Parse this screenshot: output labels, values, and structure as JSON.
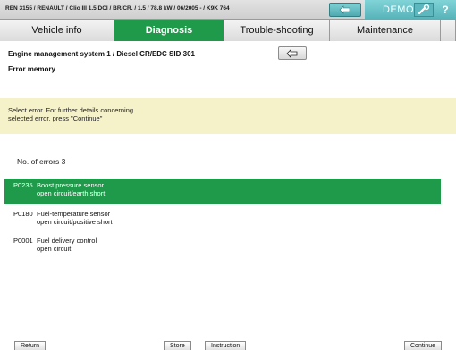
{
  "header": {
    "vehicle_id": "REN 3155 / RENAULT / Clio III 1.5 DCI / BR/CR. / 1.5 / 78.8 kW / 06/2005 - / K9K 764",
    "demo_label": "DEMO",
    "help_label": "?"
  },
  "tabs": [
    {
      "label": "Vehicle info"
    },
    {
      "label": "Diagnosis"
    },
    {
      "label": "Trouble-shooting"
    },
    {
      "label": "Maintenance"
    }
  ],
  "main": {
    "system_title": "Engine management system 1 / Diesel CR/EDC SID 301",
    "section_title": "Error memory",
    "instruction_line1": "Select error. For further details concerning",
    "instruction_line2": "selected error, press \"Continue\"",
    "error_count": "No. of errors 3"
  },
  "errors": [
    {
      "code": "P0235",
      "desc1": "Boost pressure sensor",
      "desc2": "open circuit/earth short"
    },
    {
      "code": "P0180",
      "desc1": "Fuel-temperature sensor",
      "desc2": "open circuit/positive short"
    },
    {
      "code": "P0001",
      "desc1": "Fuel delivery control",
      "desc2": "open circuit"
    }
  ],
  "buttons": {
    "return": "Return",
    "store": "Store",
    "instruction": "Instruction",
    "continue": "Continue"
  },
  "colors": {
    "accent_green": "#1f9a4a",
    "header_teal": "#56b2b8",
    "instruction_yellow": "#f5f1c8"
  },
  "icons": {
    "back": "back-arrow-icon",
    "tools": "wrench-icon",
    "help": "question-mark-icon"
  }
}
